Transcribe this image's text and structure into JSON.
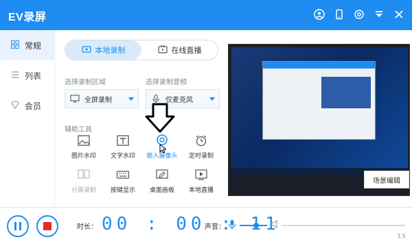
{
  "app": {
    "title": "EV录屏"
  },
  "sidebar": {
    "items": [
      {
        "label": "常规",
        "icon": "grid-icon",
        "active": true
      },
      {
        "label": "列表",
        "icon": "list-icon",
        "active": false
      },
      {
        "label": "会员",
        "icon": "diamond-icon",
        "active": false
      }
    ]
  },
  "mode": {
    "tabs": [
      {
        "label": "本地录制",
        "icon": "video-icon",
        "active": true
      },
      {
        "label": "在线直播",
        "icon": "tv-icon",
        "active": false
      }
    ]
  },
  "record": {
    "area_label": "选择录制区域",
    "area_value": "全屏录制",
    "audio_label": "选择录制音频",
    "audio_value": "仅麦克风"
  },
  "tools": {
    "label": "辅助工具",
    "items": [
      {
        "label": "图片水印",
        "icon": "image-icon",
        "enabled": true
      },
      {
        "label": "文字水印",
        "icon": "text-icon",
        "enabled": true
      },
      {
        "label": "嵌入摄像头",
        "icon": "camera-icon",
        "enabled": true,
        "highlighted": true
      },
      {
        "label": "定时录制",
        "icon": "alarm-icon",
        "enabled": true
      },
      {
        "label": "分屏录制",
        "icon": "split-screen-icon",
        "enabled": false
      },
      {
        "label": "按键显示",
        "icon": "keyboard-icon",
        "enabled": true
      },
      {
        "label": "桌面画板",
        "icon": "drawing-board-icon",
        "enabled": true
      },
      {
        "label": "本地直播",
        "icon": "local-live-icon",
        "enabled": true
      }
    ]
  },
  "preview": {
    "scene_button": "场景编辑"
  },
  "status": {
    "duration_label": "时长：",
    "time": "00:00:11",
    "volume_label": "声音：",
    "mic_level": 0.6,
    "version": "3.5"
  },
  "colors": {
    "accent": "#1e8cf0",
    "stop": "#e02d2d"
  }
}
